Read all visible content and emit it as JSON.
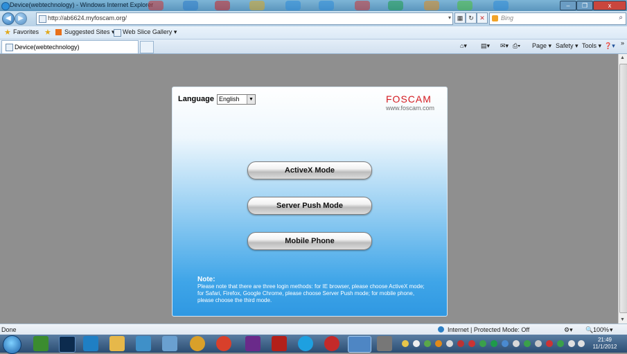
{
  "window": {
    "title": "Device(webtechnology) - Windows Internet Explorer",
    "controls": {
      "minimize": "–",
      "maximize": "❐",
      "close": "x"
    }
  },
  "address_bar": {
    "url": "http://ab6624.myfoscam.org/",
    "search_placeholder": "Bing",
    "back": "◀",
    "forward": "▶"
  },
  "favorites_bar": {
    "favorites": "Favorites",
    "suggested_sites": "Suggested Sites ▾",
    "web_slice_gallery": "Web Slice Gallery ▾"
  },
  "tabs": [
    {
      "label": "Device(webtechnology)"
    }
  ],
  "command_bar": {
    "page": "Page ▾",
    "safety": "Safety ▾",
    "tools": "Tools ▾",
    "help": "❓▾",
    "more": "»"
  },
  "page": {
    "language_label": "Language",
    "language_value": "English",
    "logo": "FOSCAM",
    "logo_url": "www.foscam.com",
    "buttons": {
      "activex": "ActiveX Mode",
      "server_push": "Server Push Mode",
      "mobile": "Mobile Phone"
    },
    "note_title": "Note:",
    "note_text": "Please note that there are three login methods: for IE browser, please choose ActiveX mode; for Safari, Firefox, Google Chrome, please choose Server Push mode; for mobile phone, please choose the third mode."
  },
  "status_bar": {
    "left": "Done",
    "zone": "Internet | Protected Mode: Off",
    "zoom": "100%"
  },
  "clock": {
    "time": "21:49",
    "date": "11/1/2012"
  },
  "colors": {
    "panel_top": "#ffffff",
    "panel_bottom": "#2f98e2",
    "logo": "#d4191f",
    "workspace": "#8f8f8f"
  }
}
